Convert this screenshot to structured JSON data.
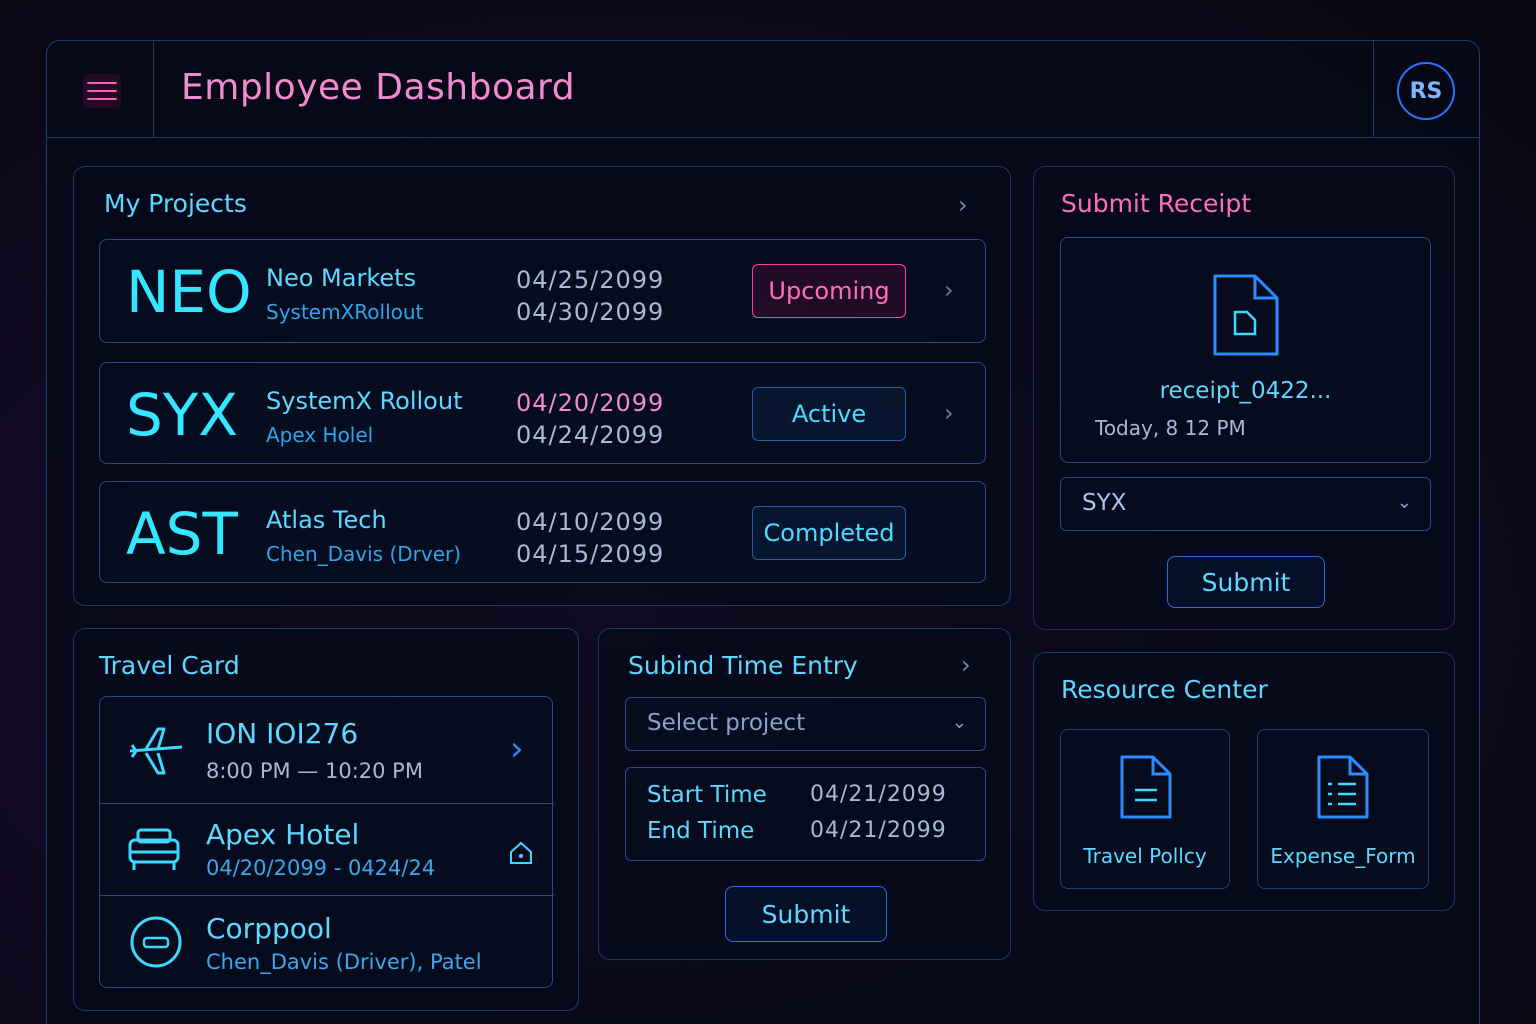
{
  "app": {
    "title": "Employee Dashboard",
    "avatar_initials": "RS"
  },
  "projects": {
    "title": "My Projects",
    "rows": [
      {
        "code": "NEO",
        "name": "Neo Markets",
        "sub": "SystemXRollout",
        "start": "04/25/2099",
        "end": "04/30/2099",
        "status": "Upcoming"
      },
      {
        "code": "SYX",
        "name": "SystemX Rollout",
        "sub": "Apex Holel",
        "start": "04/20/2099",
        "end": "04/24/2099",
        "status": "Active"
      },
      {
        "code": "AST",
        "name": "Atlas Tech",
        "sub": "Chen_Davis (Drver)",
        "start": "04/10/2099",
        "end": "04/15/2099",
        "status": "Completed"
      }
    ]
  },
  "travel": {
    "title": "Travel Card",
    "flight": {
      "title": "ION IOI276",
      "times": "8:00 PM  —  10:20 PM"
    },
    "hotel": {
      "title": "Apex Hotel",
      "dates": "04/20/2099 - 0424/24"
    },
    "carpool": {
      "title": "Corppool",
      "people": "Chen_Davis (Driver),  Patel"
    }
  },
  "time_entry": {
    "title": "Subind Time Entry",
    "select_placeholder": "Select project",
    "start_label": "Start Time",
    "start_value": "04/21/2099",
    "end_label": "End Time",
    "end_value": "04/21/2099",
    "submit_label": "Submit"
  },
  "receipt": {
    "title": "Submit Receipt",
    "file_name": "receipt_0422...",
    "file_time": "Today, 8 12 PM",
    "project_value": "SYX",
    "submit_label": "Submit"
  },
  "resources": {
    "title": "Resource Center",
    "items": [
      {
        "label": "Travel Pollcy",
        "icon": "document-icon"
      },
      {
        "label": "Expense_Form",
        "icon": "list-document-icon"
      }
    ]
  },
  "colors": {
    "accent_cyan": "#34e6ff",
    "accent_pink": "#ff5fb0",
    "border_blue": "#2a4a86"
  }
}
